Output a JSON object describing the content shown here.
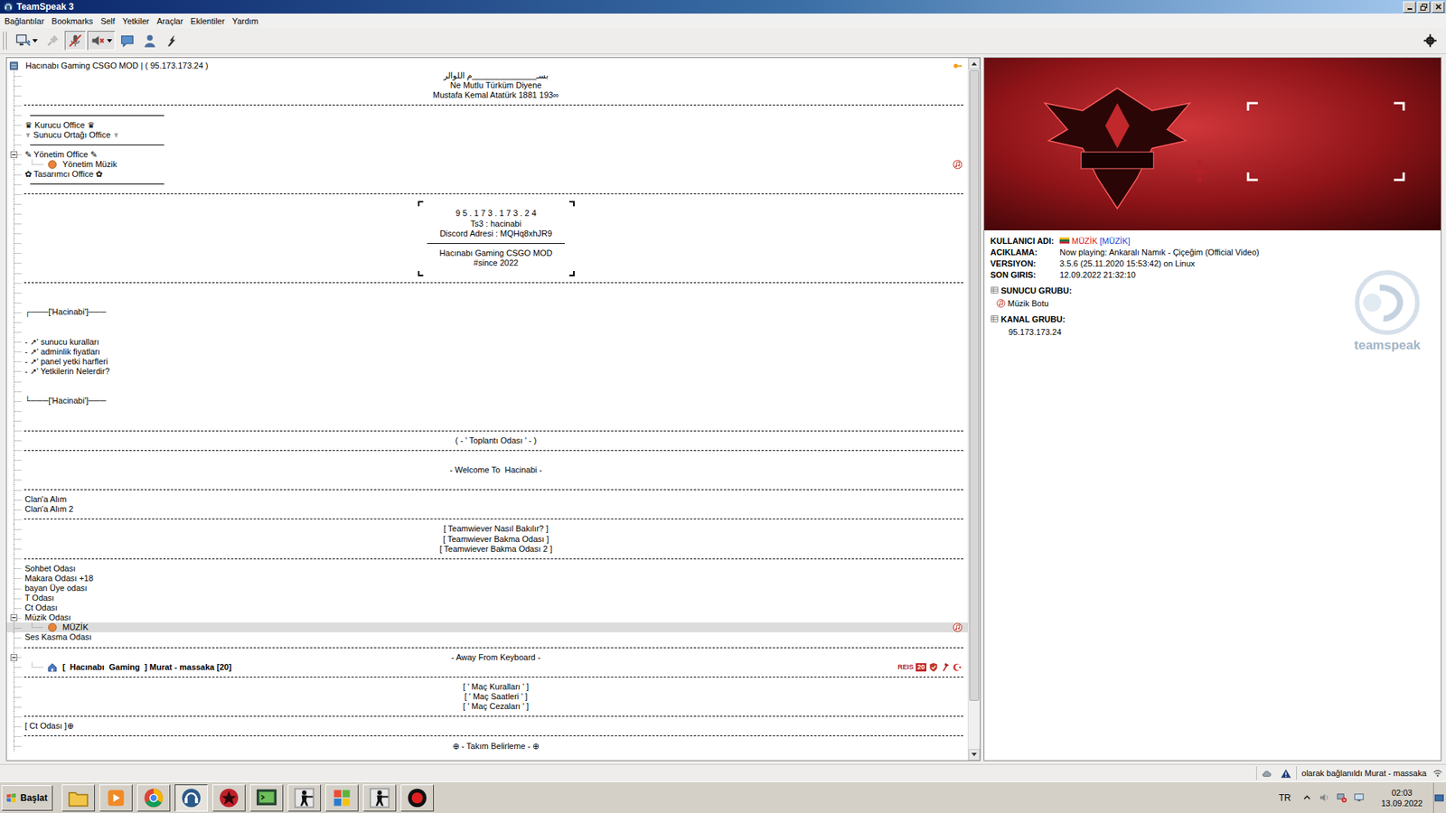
{
  "window": {
    "title": "TeamSpeak 3"
  },
  "menu": [
    "Bağlantılar",
    "Bookmarks",
    "Self",
    "Yetkiler",
    "Araçlar",
    "Eklentiler",
    "Yardım"
  ],
  "toolbar": {
    "left": [
      {
        "kind": "connect",
        "dropdown": true,
        "pressed": false,
        "disabled": false
      },
      {
        "kind": "disconnect",
        "dropdown": false,
        "pressed": false,
        "disabled": true
      },
      {
        "kind": "mute-mic",
        "dropdown": false,
        "pressed": true,
        "disabled": false
      },
      {
        "kind": "mute-speaker",
        "dropdown": true,
        "pressed": true,
        "disabled": false
      },
      {
        "kind": "away",
        "dropdown": false,
        "pressed": false,
        "disabled": false
      },
      {
        "kind": "contacts",
        "dropdown": false,
        "pressed": false,
        "disabled": false
      },
      {
        "kind": "whisper",
        "dropdown": false,
        "pressed": false,
        "disabled": false
      }
    ],
    "right": [
      {
        "kind": "gear",
        "dropdown": false,
        "pressed": false,
        "disabled": false
      }
    ]
  },
  "tree": {
    "scroll": {
      "level": 0.93
    },
    "rows": [
      {
        "kind": "server",
        "text": "Hacınabı Gaming CSGO MOD | ( 95.173.173.24 )",
        "selected": false,
        "badges": [
          {
            "kind": "key"
          }
        ]
      },
      {
        "kind": "center",
        "text": "بسـ______________م اللوالر",
        "selected": false
      },
      {
        "kind": "center",
        "text": "Ne Mutlu Türküm Diyene",
        "selected": false
      },
      {
        "kind": "center",
        "text": "Mustafa Kemal Atatürk 1881 193∞",
        "selected": false
      },
      {
        "kind": "dash",
        "selected": false
      },
      {
        "kind": "rule",
        "selected": false
      },
      {
        "kind": "left",
        "text": "♛ Kurucu Office ♛",
        "selected": false
      },
      {
        "kind": "left",
        "text": "♆ Sunucu Ortağı Office ♆",
        "selected": false
      },
      {
        "kind": "rule",
        "selected": false
      },
      {
        "kind": "left",
        "text": "✎ Yönetim Office ✎",
        "selected": false,
        "expanded": true
      },
      {
        "kind": "client",
        "text": "Yönetim Müzik",
        "marker": "dot",
        "self": false,
        "selected": false,
        "badges": [
          {
            "kind": "music"
          }
        ]
      },
      {
        "kind": "left",
        "text": "✿ Tasarımcı Office ✿",
        "selected": false
      },
      {
        "kind": "rule",
        "selected": false
      },
      {
        "kind": "dash",
        "selected": false
      },
      {
        "kind": "frame-top",
        "selected": false
      },
      {
        "kind": "center",
        "text": "9 5 . 1 7 3 . 1 7 3 . 2 4",
        "selected": false
      },
      {
        "kind": "center",
        "text": "Ts3 : hacinabi",
        "selected": false
      },
      {
        "kind": "center",
        "text": "Discord Adresi : MQHq8xhJR9",
        "selected": false
      },
      {
        "kind": "center-rule",
        "selected": false
      },
      {
        "kind": "center",
        "text": "Hacınabı Gaming CSGO MOD",
        "selected": false
      },
      {
        "kind": "center",
        "text": "#since 2022",
        "selected": false
      },
      {
        "kind": "frame-bottom",
        "selected": false
      },
      {
        "kind": "dash",
        "selected": false
      },
      {
        "kind": "empty",
        "selected": false
      },
      {
        "kind": "empty",
        "selected": false
      },
      {
        "kind": "left",
        "text": "┌───['Hacinabi']───",
        "selected": false
      },
      {
        "kind": "empty",
        "selected": false
      },
      {
        "kind": "empty",
        "selected": false
      },
      {
        "kind": "left",
        "text": "- ➚' sunucu kuralları",
        "selected": false
      },
      {
        "kind": "left",
        "text": "- ➚' adminlik fiyatları",
        "selected": false
      },
      {
        "kind": "left",
        "text": "- ➚' panel yetki harfleri",
        "selected": false
      },
      {
        "kind": "left",
        "text": "- ➚' Yetkilerin Nelerdir?",
        "selected": false
      },
      {
        "kind": "empty",
        "selected": false
      },
      {
        "kind": "empty",
        "selected": false
      },
      {
        "kind": "left",
        "text": "└───['Hacinabi']───",
        "selected": false
      },
      {
        "kind": "empty",
        "selected": false
      },
      {
        "kind": "empty",
        "selected": false
      },
      {
        "kind": "dash",
        "selected": false
      },
      {
        "kind": "center",
        "text": "( - ' Toplantı Odası ' - )",
        "selected": false
      },
      {
        "kind": "dash",
        "selected": false
      },
      {
        "kind": "empty",
        "selected": false
      },
      {
        "kind": "center",
        "text": "- Welcome To  Hacinabi -",
        "selected": false
      },
      {
        "kind": "empty",
        "selected": false
      },
      {
        "kind": "dash",
        "selected": false
      },
      {
        "kind": "left",
        "text": "Clan'a Alım",
        "selected": false
      },
      {
        "kind": "left",
        "text": "Clan'a Alım 2",
        "selected": false
      },
      {
        "kind": "dash",
        "selected": false
      },
      {
        "kind": "center",
        "text": "[ Teamwiever Nasıl Bakılır? ]",
        "selected": false
      },
      {
        "kind": "center",
        "text": "[ Teamwiever Bakma Odası ]",
        "selected": false
      },
      {
        "kind": "center",
        "text": "[ Teamwiever Bakma Odası 2 ]",
        "selected": false
      },
      {
        "kind": "dash",
        "selected": false
      },
      {
        "kind": "left",
        "text": "Sohbet Odası",
        "selected": false
      },
      {
        "kind": "left",
        "text": "Makara Odası +18",
        "selected": false
      },
      {
        "kind": "left",
        "text": "bayan Üye odası",
        "selected": false
      },
      {
        "kind": "left",
        "text": "T Odası",
        "selected": false
      },
      {
        "kind": "left",
        "text": "Ct Odası",
        "selected": false
      },
      {
        "kind": "left",
        "text": "Müzik Odası",
        "selected": false,
        "expanded": true
      },
      {
        "kind": "client",
        "text": "MÜZİK",
        "marker": "dot",
        "self": false,
        "selected": true,
        "badges": [
          {
            "kind": "music"
          }
        ]
      },
      {
        "kind": "left",
        "text": "Ses Kasma Odası",
        "selected": false
      },
      {
        "kind": "dash",
        "selected": false
      },
      {
        "kind": "center",
        "text": "- Away From Keyboard -",
        "selected": false,
        "expanded": true
      },
      {
        "kind": "client",
        "text": "[  Hacınabı  Gaming  ] Murat - massaka [20]",
        "marker": "house",
        "self": true,
        "selected": false,
        "badges": [
          {
            "kind": "label",
            "label": "REIS"
          },
          {
            "kind": "count",
            "label": "20"
          },
          {
            "kind": "shield"
          },
          {
            "kind": "axe"
          },
          {
            "kind": "crescent"
          }
        ]
      },
      {
        "kind": "dash",
        "selected": false
      },
      {
        "kind": "center",
        "text": "[ ' Maç Kuralları ' ]",
        "selected": false
      },
      {
        "kind": "center",
        "text": "[ ' Maç Saatleri ' ]",
        "selected": false
      },
      {
        "kind": "center",
        "text": "[ ' Maç Cezaları ' ]",
        "selected": false
      },
      {
        "kind": "dash",
        "selected": false
      },
      {
        "kind": "left",
        "text": "[ Ct Odası ]⊕",
        "selected": false
      },
      {
        "kind": "dash",
        "selected": false
      },
      {
        "kind": "center",
        "text": "⊕ - Takım Belirleme - ⊕",
        "selected": false
      }
    ]
  },
  "info": {
    "nickname": {
      "label": "KULLANICI ADI:",
      "name": "MÜZİK",
      "tag": "[MÜZİK]"
    },
    "rows": [
      {
        "label": "ACIKLAMA:",
        "value": "Now playing: Ankaralı Namık - Çiçeğim (Official Video)"
      },
      {
        "label": "VERSIYON:",
        "value": "3.5.6 (25.11.2020 15:53:42) on Linux"
      },
      {
        "label": "SON GIRIS:",
        "value": "12.09.2022 21:32:10"
      }
    ],
    "groups": [
      {
        "label": "SUNUCU GRUBU:",
        "items": [
          {
            "name": "Müzik Botu",
            "kind": "music"
          }
        ]
      },
      {
        "label": "KANAL GRUBU:",
        "items": [
          {
            "name": "95.173.173.24",
            "kind": "none"
          }
        ]
      }
    ],
    "watermark": "teamspeak"
  },
  "status_bar": {
    "icons": [
      {
        "kind": "cloud"
      },
      {
        "kind": "warning"
      }
    ],
    "text": "olarak bağlanıldı Murat - massaka",
    "end_icons": [
      {
        "kind": "signal"
      }
    ]
  },
  "taskbar": {
    "start": "Başlat",
    "apps": [
      {
        "kind": "folder",
        "selected": false
      },
      {
        "kind": "media",
        "selected": false
      },
      {
        "kind": "chrome",
        "selected": false
      },
      {
        "kind": "teamspeak",
        "selected": true
      },
      {
        "kind": "redapp",
        "selected": false
      },
      {
        "kind": "terminal",
        "selected": false
      },
      {
        "kind": "csgo",
        "selected": false
      },
      {
        "kind": "windows",
        "selected": false
      },
      {
        "kind": "csgo",
        "selected": false
      },
      {
        "kind": "record",
        "selected": false
      }
    ],
    "language": "TR",
    "tray": [
      {
        "kind": "arrow-up"
      },
      {
        "kind": "speaker"
      },
      {
        "kind": "network-off"
      },
      {
        "kind": "monitor"
      }
    ],
    "time": "02:03",
    "date": "13.09.2022"
  }
}
